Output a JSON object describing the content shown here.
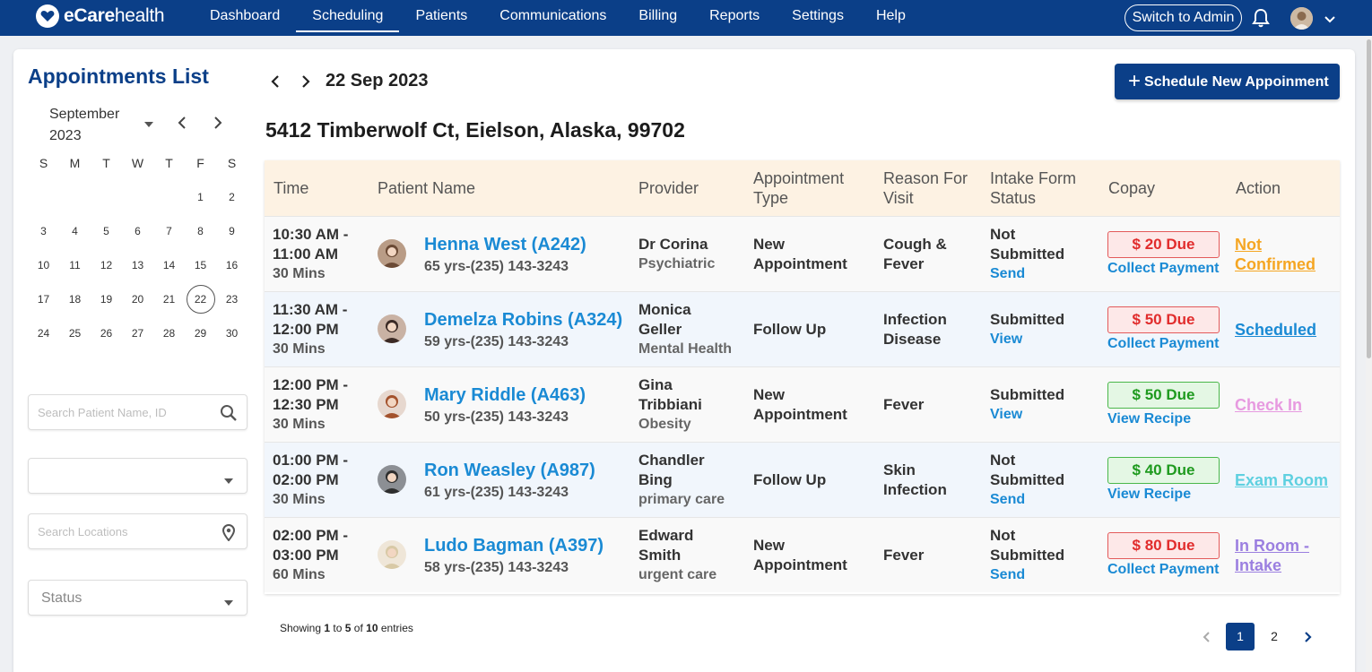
{
  "app": {
    "logo_text_bold": "eCare",
    "logo_text_light": "health",
    "nav": [
      {
        "label": "Dashboard"
      },
      {
        "label": "Scheduling"
      },
      {
        "label": "Patients"
      },
      {
        "label": "Communications"
      },
      {
        "label": "Billing"
      },
      {
        "label": "Reports"
      },
      {
        "label": "Settings"
      },
      {
        "label": "Help"
      }
    ],
    "active_nav": "Scheduling",
    "switch_admin": "Switch to Admin",
    "colors": {
      "primary": "#0b3f88",
      "link": "#1a8ad4"
    }
  },
  "sidebar": {
    "title": "Appointments List",
    "calendar": {
      "month": "September",
      "year": "2023",
      "weekdays": [
        "S",
        "M",
        "T",
        "W",
        "T",
        "F",
        "S"
      ],
      "weeks": [
        [
          "",
          "",
          "",
          "",
          "",
          "1",
          "2"
        ],
        [
          "3",
          "4",
          "5",
          "6",
          "7",
          "8",
          "9"
        ],
        [
          "10",
          "11",
          "12",
          "13",
          "14",
          "15",
          "16"
        ],
        [
          "17",
          "18",
          "19",
          "20",
          "21",
          "22",
          "23"
        ],
        [
          "24",
          "25",
          "26",
          "27",
          "28",
          "29",
          "30"
        ]
      ],
      "selected_day": "22"
    },
    "search_patient_placeholder": "Search Patient Name, ID",
    "provider_select_value": "",
    "search_location_placeholder": "Search Locations",
    "status_placeholder": "Status"
  },
  "main": {
    "date": "22 Sep 2023",
    "new_appointment_button": "Schedule New Appoinment",
    "location_address": "5412 Timberwolf Ct, Eielson, Alaska, 99702",
    "table": {
      "headers": {
        "time": "Time",
        "patient_name": "Patient Name",
        "provider": "Provider",
        "appointment_type_1": "Appointment",
        "appointment_type_2": "Type",
        "reason_1": "Reason For",
        "reason_2": "Visit",
        "intake_1": "Intake Form",
        "intake_2": "Status",
        "copay": "Copay",
        "action": "Action"
      },
      "rows": [
        {
          "time_1": "10:30 AM -",
          "time_2": "11:00 AM",
          "duration": "30 Mins",
          "patient": "Henna West (A242)",
          "info": "65 yrs-(235) 143-3243",
          "provider_1": "Dr Corina",
          "provider_2": "",
          "specialty": "Psychiatric",
          "type_1": "New",
          "type_2": "Appointment",
          "reason_1": "Cough &",
          "reason_2": "Fever",
          "intake_1": "Not",
          "intake_2": "Submitted",
          "intake_link": "Send",
          "copay": "$ 20 Due",
          "copay_status": "red",
          "copay_link": "Collect Payment",
          "action_1": "Not",
          "action_2": "Confirmed",
          "action_color": "#f5a623"
        },
        {
          "time_1": "11:30 AM -",
          "time_2": "12:00 PM",
          "duration": "30 Mins",
          "patient": "Demelza Robins (A324)",
          "info": "59 yrs-(235) 143-3243",
          "provider_1": "Monica",
          "provider_2": "Geller",
          "specialty": "Mental Health",
          "type_1": "Follow Up",
          "type_2": "",
          "reason_1": "Infection",
          "reason_2": "Disease",
          "intake_1": "Submitted",
          "intake_2": "",
          "intake_link": "View",
          "copay": "$ 50 Due",
          "copay_status": "red",
          "copay_link": "Collect Payment",
          "action_1": "Scheduled",
          "action_2": "",
          "action_color": "#1a8ad4"
        },
        {
          "time_1": "12:00 PM -",
          "time_2": "12:30 PM",
          "duration": "30 Mins",
          "patient": "Mary Riddle (A463)",
          "info": "50 yrs-(235) 143-3243",
          "provider_1": "Gina",
          "provider_2": "Tribbiani",
          "specialty": "Obesity",
          "type_1": "New",
          "type_2": "Appointment",
          "reason_1": "Fever",
          "reason_2": "",
          "intake_1": "Submitted",
          "intake_2": "",
          "intake_link": "View",
          "copay": "$ 50 Due",
          "copay_status": "green",
          "copay_link": "View Recipe",
          "action_1": "Check In",
          "action_2": "",
          "action_color": "#e79ae0"
        },
        {
          "time_1": "01:00 PM -",
          "time_2": "02:00 PM",
          "duration": "30 Mins",
          "patient": "Ron Weasley (A987)",
          "info": "61 yrs-(235) 143-3243",
          "provider_1": "Chandler",
          "provider_2": "Bing",
          "specialty": "primary care",
          "type_1": "Follow Up",
          "type_2": "",
          "reason_1": "Skin",
          "reason_2": "Infection",
          "intake_1": "Not",
          "intake_2": "Submitted",
          "intake_link": "Send",
          "copay": "$ 40 Due",
          "copay_status": "green",
          "copay_link": "View Recipe",
          "action_1": "Exam Room",
          "action_2": "",
          "action_color": "#5fd0e0"
        },
        {
          "time_1": "02:00 PM -",
          "time_2": "03:00 PM",
          "duration": "60 Mins",
          "patient": "Ludo Bagman (A397)",
          "info": "58 yrs-(235) 143-3243",
          "provider_1": "Edward",
          "provider_2": "Smith",
          "specialty": "urgent care",
          "type_1": "New",
          "type_2": "Appointment",
          "reason_1": "Fever",
          "reason_2": "",
          "intake_1": "Not",
          "intake_2": "Submitted",
          "intake_link": "Send",
          "copay": "$ 80 Due",
          "copay_status": "red",
          "copay_link": "Collect Payment",
          "action_1": "In Room -",
          "action_2": "Intake",
          "action_color": "#9b7fe0"
        }
      ]
    },
    "footer": {
      "showing_prefix": "Showing",
      "from": "1",
      "to_word": "to",
      "to": "5",
      "of_word": "of",
      "total": "10",
      "entries_word": "entries",
      "pages": [
        "1",
        "2"
      ],
      "current_page": "1"
    }
  }
}
